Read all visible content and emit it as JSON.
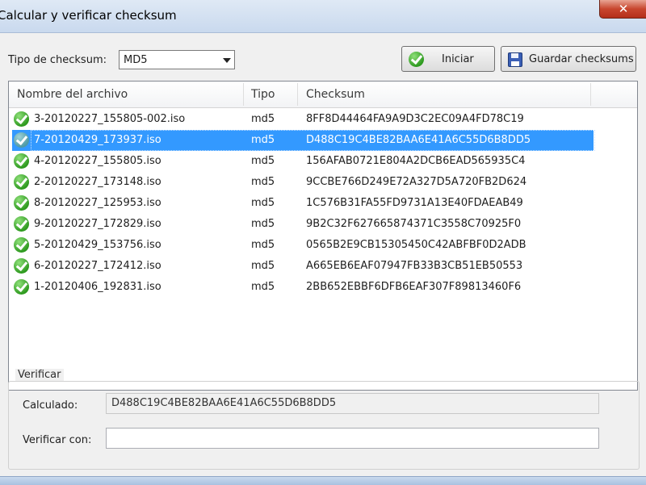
{
  "window": {
    "title": "Calcular y verificar checksum",
    "close_label": "✕"
  },
  "toolbar": {
    "checksum_type_label": "Tipo de checksum:",
    "checksum_type_value": "MD5",
    "start_label": "Iniciar",
    "save_label": "Guardar checksums"
  },
  "list": {
    "columns": [
      "Nombre del archivo",
      "Tipo",
      "Checksum"
    ],
    "rows": [
      {
        "name": "3-20120227_155805-002.iso",
        "type": "md5",
        "checksum": "8FF8D44464FA9A9D3C2EC09A4FD78C19",
        "selected": false
      },
      {
        "name": "7-20120429_173937.iso",
        "type": "md5",
        "checksum": "D488C19C4BE82BAA6E41A6C55D6B8DD5",
        "selected": true
      },
      {
        "name": "4-20120227_155805.iso",
        "type": "md5",
        "checksum": "156AFAB0721E804A2DCB6EAD565935C4",
        "selected": false
      },
      {
        "name": "2-20120227_173148.iso",
        "type": "md5",
        "checksum": "9CCBE766D249E72A327D5A720FB2D624",
        "selected": false
      },
      {
        "name": "8-20120227_125953.iso",
        "type": "md5",
        "checksum": "1C576B31FA55FD9731A13E40FDAEAB49",
        "selected": false
      },
      {
        "name": "9-20120227_172829.iso",
        "type": "md5",
        "checksum": "9B2C32F627665874371C3558C70925F0",
        "selected": false
      },
      {
        "name": "5-20120429_153756.iso",
        "type": "md5",
        "checksum": "0565B2E9CB15305450C42ABFBF0D2ADB",
        "selected": false
      },
      {
        "name": "6-20120227_172412.iso",
        "type": "md5",
        "checksum": "A665EB6EAF07947FB33B3CB51EB50553",
        "selected": false
      },
      {
        "name": "1-20120406_192831.iso",
        "type": "md5",
        "checksum": "2BB652EBBF6DFB6EAF307F89813460F6",
        "selected": false
      }
    ]
  },
  "verify": {
    "group_title": "Verificar",
    "calculated_label": "Calculado:",
    "calculated_value": "D488C19C4BE82BAA6E41A6C55D6B8DD5",
    "verify_with_label": "Verificar con:",
    "verify_with_value": ""
  },
  "icons": {
    "row_status": "check-circle-icon",
    "start": "check-circle-icon",
    "save": "floppy-disk-icon",
    "combo": "chevron-down-icon"
  },
  "colors": {
    "selection": "#3399ff",
    "check_green": "#2e9a1f"
  }
}
